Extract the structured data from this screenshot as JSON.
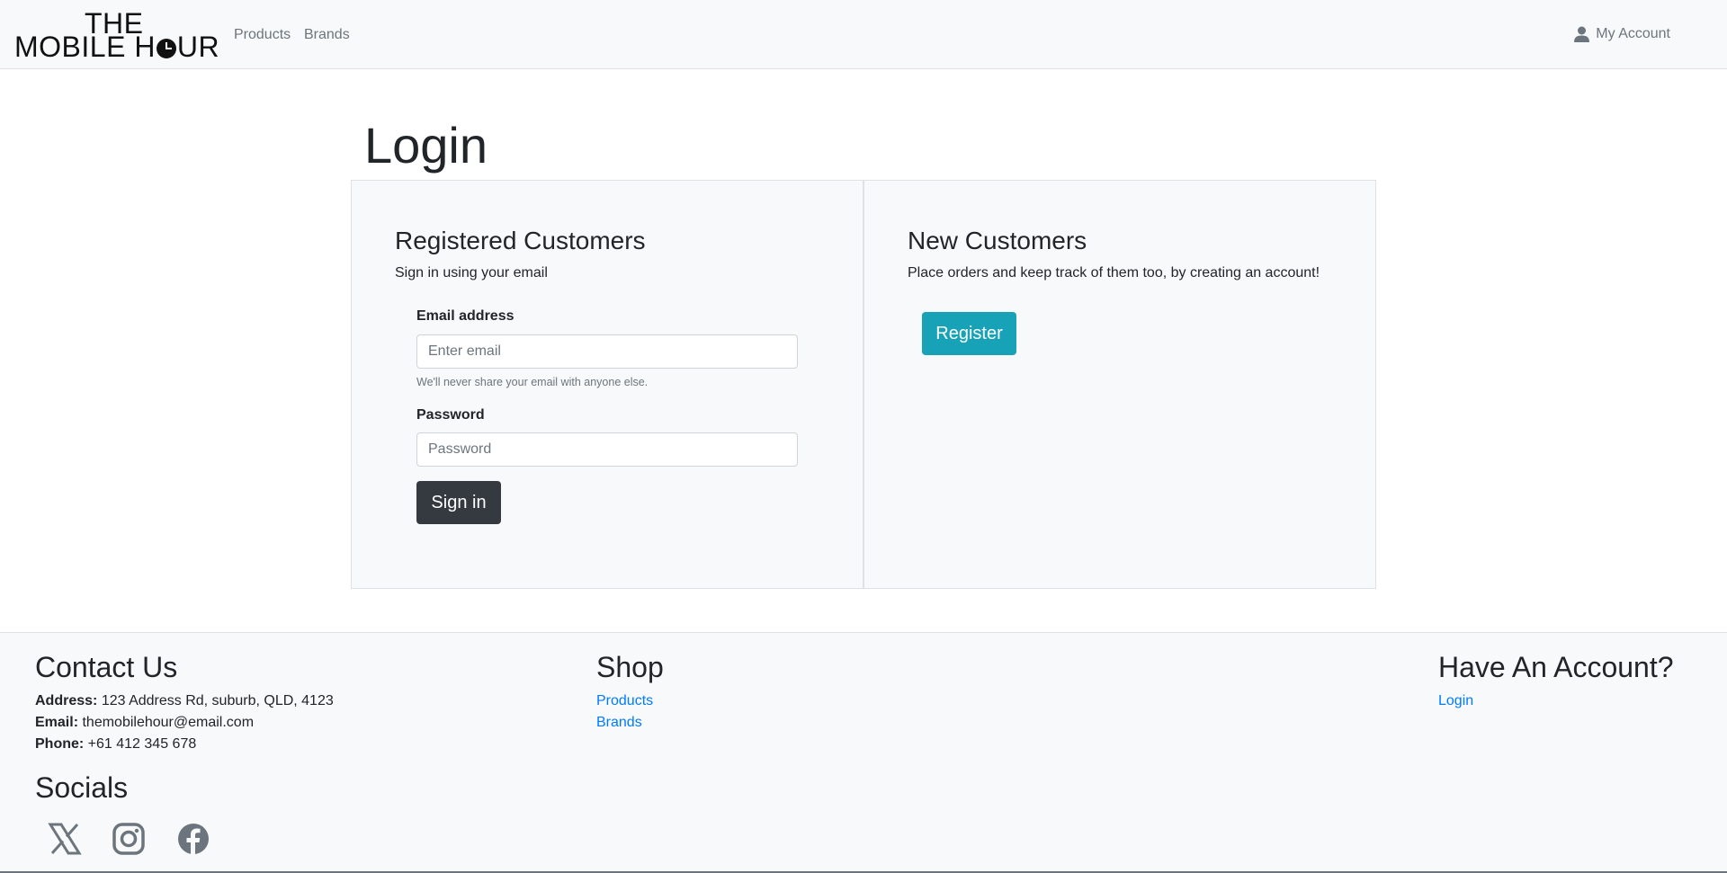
{
  "brand": {
    "line1": "THE",
    "line2_before": "MOBILE H",
    "line2_after": "UR"
  },
  "nav": {
    "products": "Products",
    "brands": "Brands",
    "account": "My Account"
  },
  "main": {
    "title": "Login",
    "registered": {
      "heading": "Registered Customers",
      "subtitle": "Sign in using your email",
      "email_label": "Email address",
      "email_placeholder": "Enter email",
      "email_help": "We'll never share your email with anyone else.",
      "password_label": "Password",
      "password_placeholder": "Password",
      "signin_label": "Sign in"
    },
    "new_customers": {
      "heading": "New Customers",
      "subtitle": "Place orders and keep track of them too, by creating an account!",
      "register_label": "Register"
    }
  },
  "footer": {
    "contact": {
      "heading": "Contact Us",
      "address_label": "Address:",
      "address_value": "123 Address Rd, suburb, QLD, 4123",
      "email_label": "Email:",
      "email_value": "themobilehour@email.com",
      "phone_label": "Phone:",
      "phone_value": "+61 412 345 678"
    },
    "shop": {
      "heading": "Shop",
      "products": "Products",
      "brands": "Brands"
    },
    "account": {
      "heading": "Have An Account?",
      "login": "Login"
    },
    "socials": {
      "heading": "Socials",
      "icons": [
        "x-icon",
        "instagram-icon",
        "facebook-icon"
      ]
    }
  },
  "colors": {
    "navbar_bg": "#f8f9fa",
    "signin_button": "#343a40",
    "register_button": "#17a2b8",
    "link": "#007bff",
    "muted": "#6c757d"
  }
}
